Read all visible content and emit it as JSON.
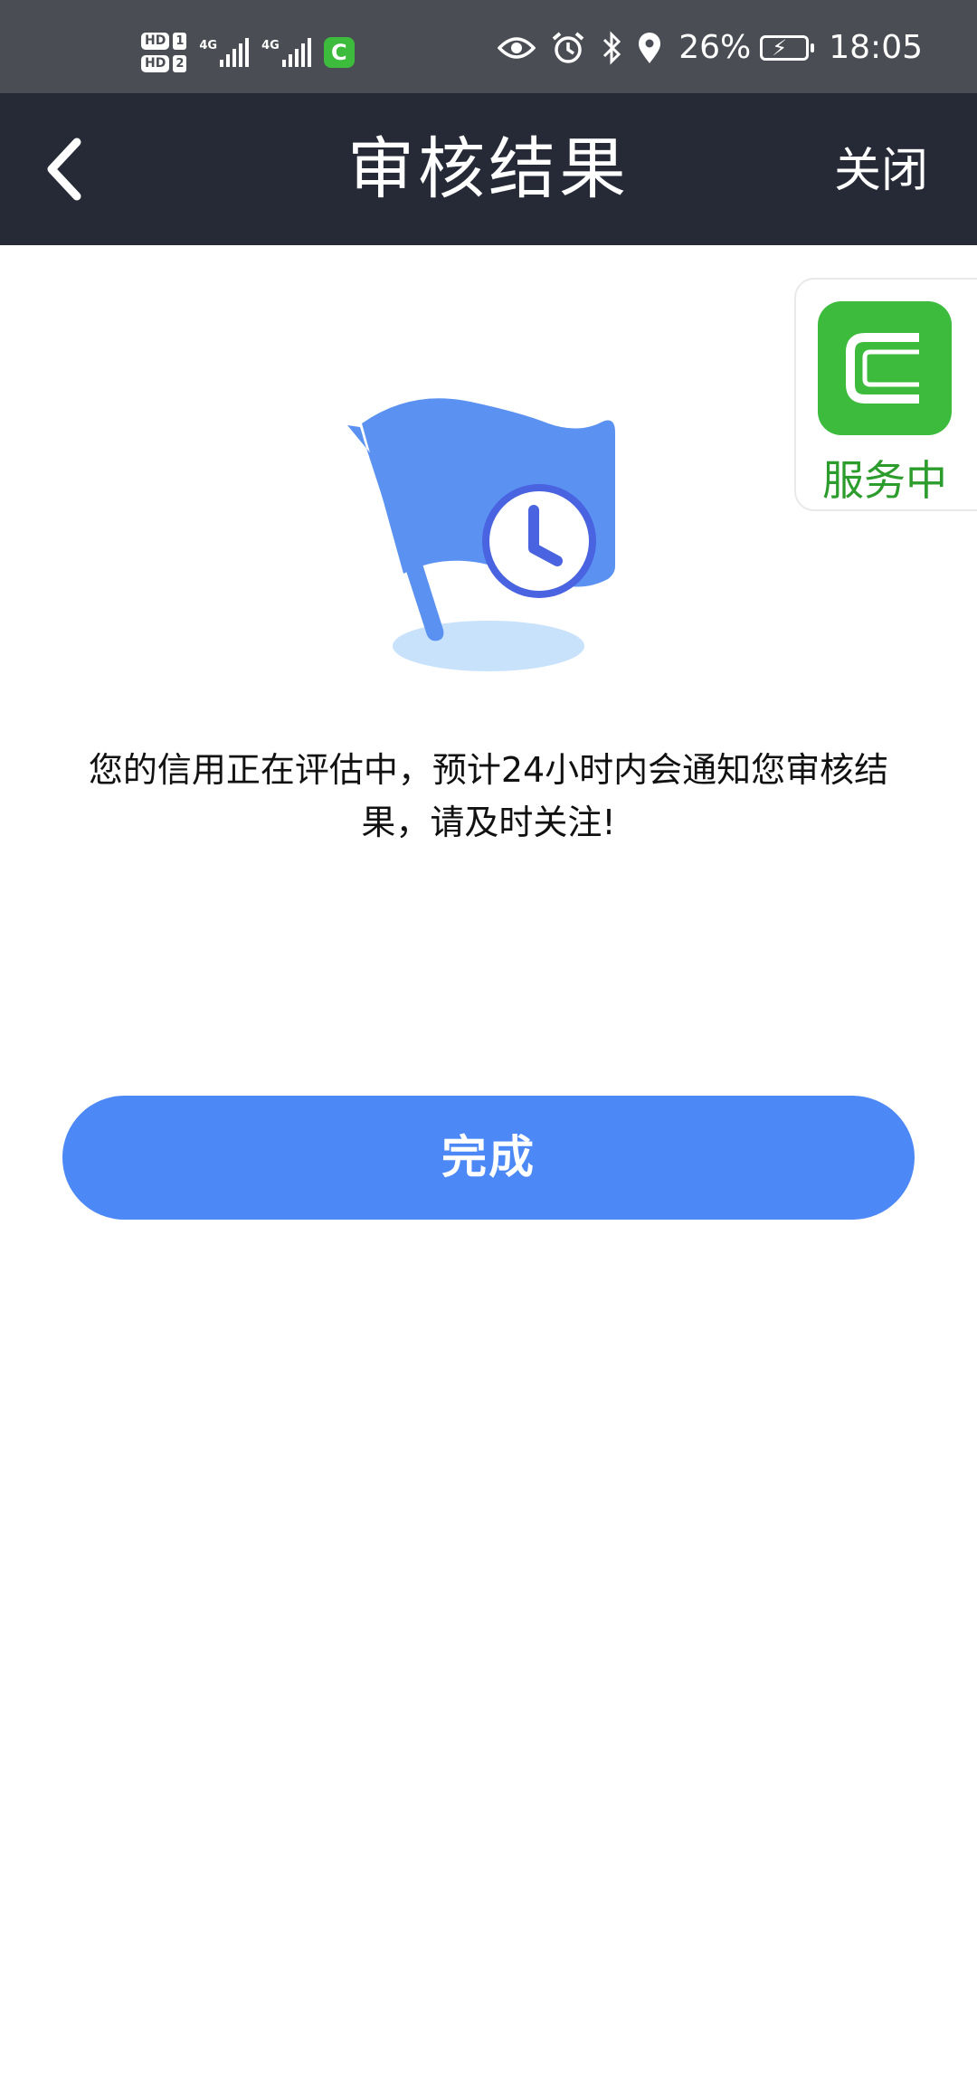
{
  "status_bar": {
    "hd1": "HD",
    "hd1_num": "1",
    "hd2": "HD",
    "hd2_num": "2",
    "sim1_label": "4G",
    "sim2_label": "4G",
    "app_icon_letter": "C",
    "battery": "26%",
    "time": "18:05",
    "icons": [
      "eye-icon",
      "alarm-icon",
      "bluetooth-icon",
      "location-icon",
      "battery-charging-icon"
    ]
  },
  "nav": {
    "back_icon": "chevron-left-icon",
    "title": "审核结果",
    "close_label": "关闭"
  },
  "service_widget": {
    "label": "服务中",
    "logo_icon": "app-c-logo-icon",
    "color": "#3dbb3d"
  },
  "illustration": {
    "icon": "flag-clock-icon",
    "color": "#4d88f7"
  },
  "message": {
    "text": "您的信用正在评估中，预计24小时内会通知您审核结果，请及时关注!"
  },
  "actions": {
    "done_label": "完成"
  },
  "colors": {
    "status_bar": "#4a4d53",
    "nav_bar": "#262a37",
    "accent": "#4d88f7"
  }
}
